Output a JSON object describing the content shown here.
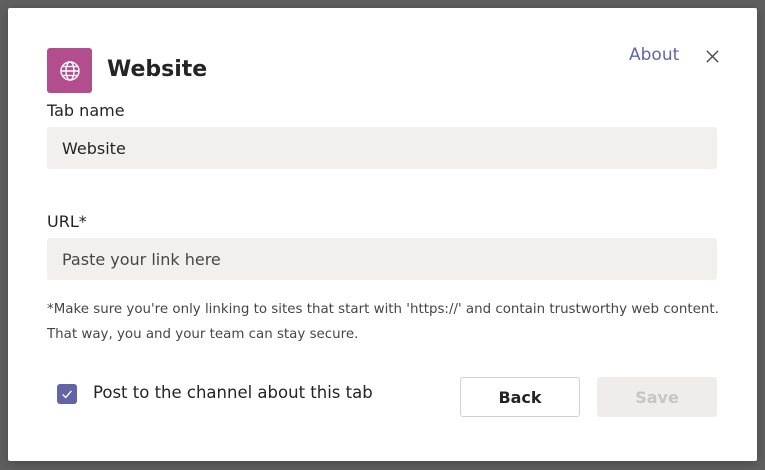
{
  "dialog": {
    "title": "Website",
    "app_icon": "globe-icon",
    "about_label": "About",
    "close_icon": "close-icon"
  },
  "form": {
    "tab_name": {
      "label": "Tab name",
      "value": "Website"
    },
    "url": {
      "label": "URL*",
      "placeholder": "Paste your link here",
      "value": ""
    },
    "note": "*Make sure you're only linking to sites that start with 'https://' and contain trustworthy web content. That way, you and your team can stay secure.",
    "post_to_channel": {
      "label": "Post to the channel about this tab",
      "checked": true
    }
  },
  "buttons": {
    "back_label": "Back",
    "save_label": "Save",
    "save_enabled": false
  },
  "colors": {
    "brand": "#b24d8e",
    "accent": "#6264a7",
    "input_bg": "#f1f0ef",
    "disabled_bg": "#eeedec",
    "disabled_text": "#c8c6c4"
  }
}
